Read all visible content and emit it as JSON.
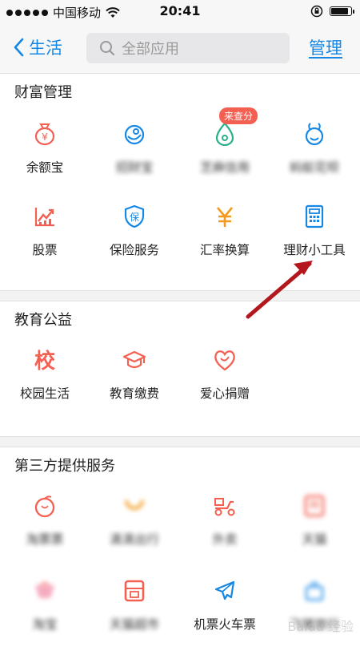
{
  "status_bar": {
    "carrier": "中国移动",
    "time": "20:41"
  },
  "nav": {
    "back_label": "生活",
    "search_placeholder": "全部应用",
    "manage_label": "管理"
  },
  "sections": {
    "wealth": {
      "title": "财富管理",
      "items": [
        {
          "label": "余额宝",
          "icon": "money-bag-icon"
        },
        {
          "label": "招财宝",
          "icon": "bird-icon"
        },
        {
          "label": "芝麻信用",
          "icon": "sesame-icon",
          "badge": "来查分"
        },
        {
          "label": "蚂蚁花呗",
          "icon": "ant-icon"
        },
        {
          "label": "股票",
          "icon": "stock-chart-icon"
        },
        {
          "label": "保险服务",
          "icon": "shield-icon"
        },
        {
          "label": "汇率换算",
          "icon": "yen-icon"
        },
        {
          "label": "理财小工具",
          "icon": "calculator-icon"
        }
      ]
    },
    "education": {
      "title": "教育公益",
      "items": [
        {
          "label": "校园生活",
          "icon": "school-char-icon"
        },
        {
          "label": "教育缴费",
          "icon": "graduation-cap-icon"
        },
        {
          "label": "爱心捐赠",
          "icon": "heart-icon"
        }
      ]
    },
    "third_party": {
      "title": "第三方提供服务",
      "items": [
        {
          "label": "淘票票",
          "icon": "peach-icon"
        },
        {
          "label": "滴滴出行",
          "icon": "didi-icon"
        },
        {
          "label": "外卖",
          "icon": "scooter-icon"
        },
        {
          "label": "天猫",
          "icon": "tmall-icon"
        },
        {
          "label": "淘宝",
          "icon": "taobao-icon"
        },
        {
          "label": "天猫超市",
          "icon": "supermarket-icon"
        },
        {
          "label": "机票火车票",
          "icon": "airplane-icon"
        },
        {
          "label": "飞猪旅行",
          "icon": "travel-icon"
        }
      ]
    }
  },
  "colors": {
    "accent_blue": "#1688e4",
    "icon_red": "#f36052",
    "icon_orange": "#f39a1e",
    "badge_red": "#f36052"
  },
  "watermark": "Baidu 经验"
}
